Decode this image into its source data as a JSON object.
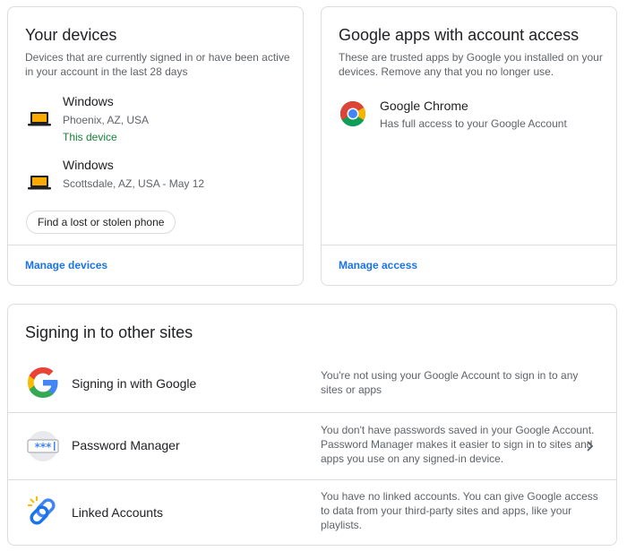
{
  "devices_card": {
    "title": "Your devices",
    "description": "Devices that are currently signed in or have been active in your account in the last 28 days",
    "devices": [
      {
        "name": "Windows",
        "location": "Phoenix, AZ, USA",
        "status": "This device",
        "icon": "laptop-icon"
      },
      {
        "name": "Windows",
        "location": "Scottsdale, AZ, USA - May 12",
        "icon": "laptop-icon"
      }
    ],
    "find_phone_label": "Find a lost or stolen phone",
    "manage_link": "Manage devices"
  },
  "apps_card": {
    "title": "Google apps with account access",
    "description": "These are trusted apps by Google you installed on your devices. Remove any that you no longer use.",
    "apps": [
      {
        "name": "Google Chrome",
        "access": "Has full access to your Google Account",
        "icon": "chrome-icon"
      }
    ],
    "manage_link": "Manage access"
  },
  "signin_card": {
    "title": "Signing in to other sites",
    "rows": [
      {
        "label": "Signing in with Google",
        "description": "You're not using your Google Account to sign in to any sites or apps",
        "icon": "google-g-icon"
      },
      {
        "label": "Password Manager",
        "description": "You don't have passwords saved in your Google Account. Password Manager makes it easier to sign in to sites and apps you use on any signed-in device.",
        "icon": "password-manager-icon"
      },
      {
        "label": "Linked Accounts",
        "description": "You have no linked accounts. You can give Google access to data from your third-party sites and apps, like your playlists.",
        "icon": "linked-accounts-icon"
      }
    ]
  },
  "colors": {
    "link": "#1a73e8",
    "this_device": "#188038",
    "border": "#dadce0",
    "laptop": "#f9ab00"
  }
}
